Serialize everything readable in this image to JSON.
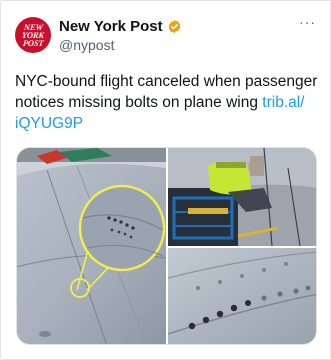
{
  "account": {
    "display_name": "New York Post",
    "handle": "@nypost",
    "avatar_logo_lines": [
      "NEW",
      "YORK",
      "POST"
    ],
    "verified_color": "#e8a317"
  },
  "tweet": {
    "text": "NYC-bound flight canceled when passenger notices missing bolts on plane wing ",
    "link_text": "trib.al/​iQYUG9P"
  },
  "menu": {
    "more_label": "···"
  },
  "colors": {
    "link": "#1d9bf0",
    "brand_red": "#c8102e",
    "highlight": "#f2ee4a"
  }
}
